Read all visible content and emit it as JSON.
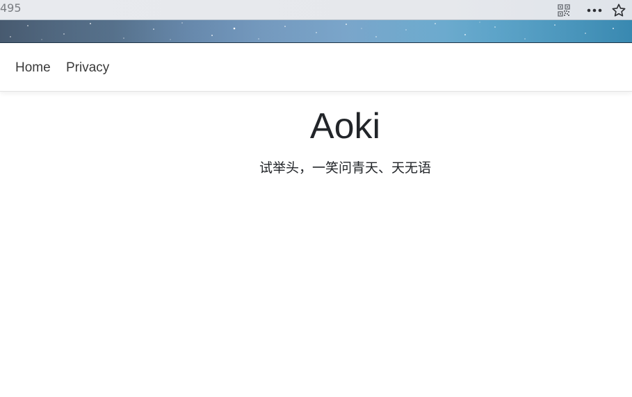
{
  "browser": {
    "url_fragment": "495",
    "icons": [
      "qr-code-icon",
      "more-options-icon",
      "favorite-star-icon"
    ]
  },
  "navbar": {
    "links": [
      {
        "label": "Home"
      },
      {
        "label": "Privacy"
      }
    ]
  },
  "hero": {
    "title": "Aoki",
    "subtitle": "试举头，一笑问青天、天无语"
  },
  "colors": {
    "text": "#222529",
    "nav_text": "#3a3a3a",
    "banner_dark": "#4b6680",
    "banner_light": "#6f9bc3"
  }
}
